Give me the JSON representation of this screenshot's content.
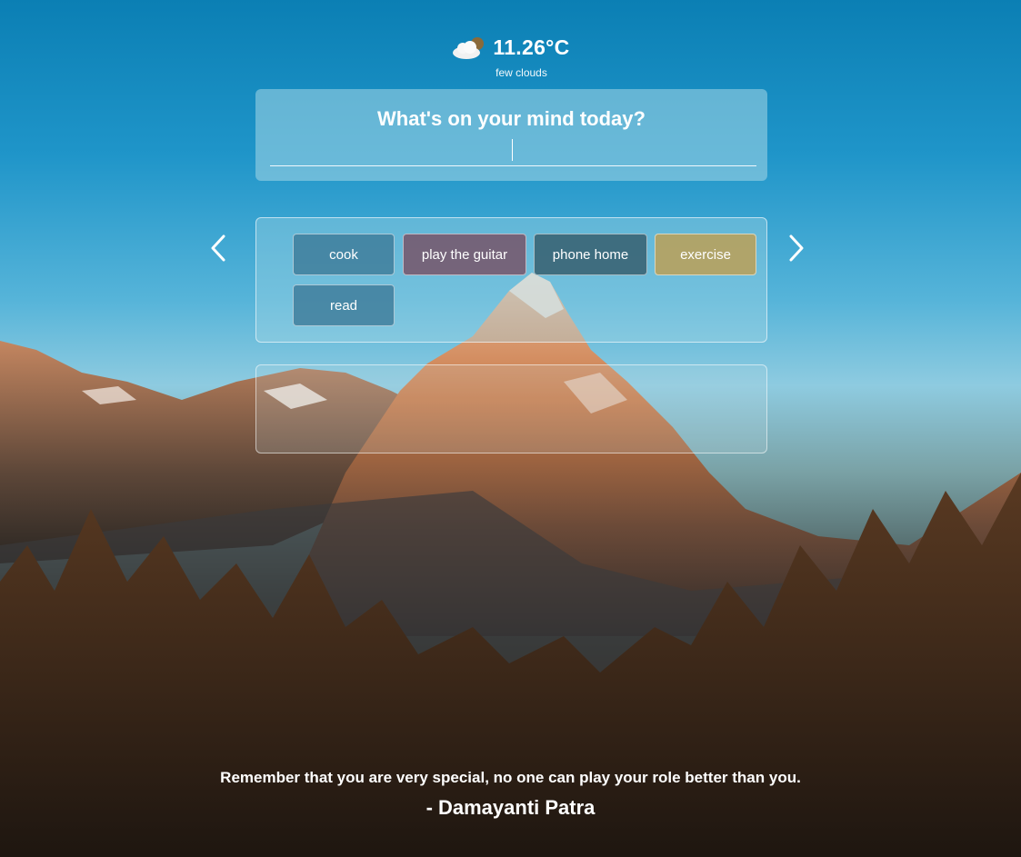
{
  "weather": {
    "icon": "cloud-sun-icon",
    "temperature": "11.26°C",
    "description": "few clouds"
  },
  "prompt": {
    "title": "What's on your mind today?",
    "input_value": "",
    "input_placeholder": ""
  },
  "tags": {
    "items": [
      {
        "label": "cook",
        "color": "#3c7896"
      },
      {
        "label": "play the guitar",
        "color": "#785064"
      },
      {
        "label": "phone home",
        "color": "#375f6e"
      },
      {
        "label": "exercise",
        "color": "#b9a05a"
      },
      {
        "label": "read",
        "color": "#3c7896"
      }
    ],
    "prev_icon": "chevron-left-icon",
    "next_icon": "chevron-right-icon"
  },
  "quote": {
    "text": "Remember that you are very special, no one can play your role better than you.",
    "author": "- Damayanti Patra"
  }
}
